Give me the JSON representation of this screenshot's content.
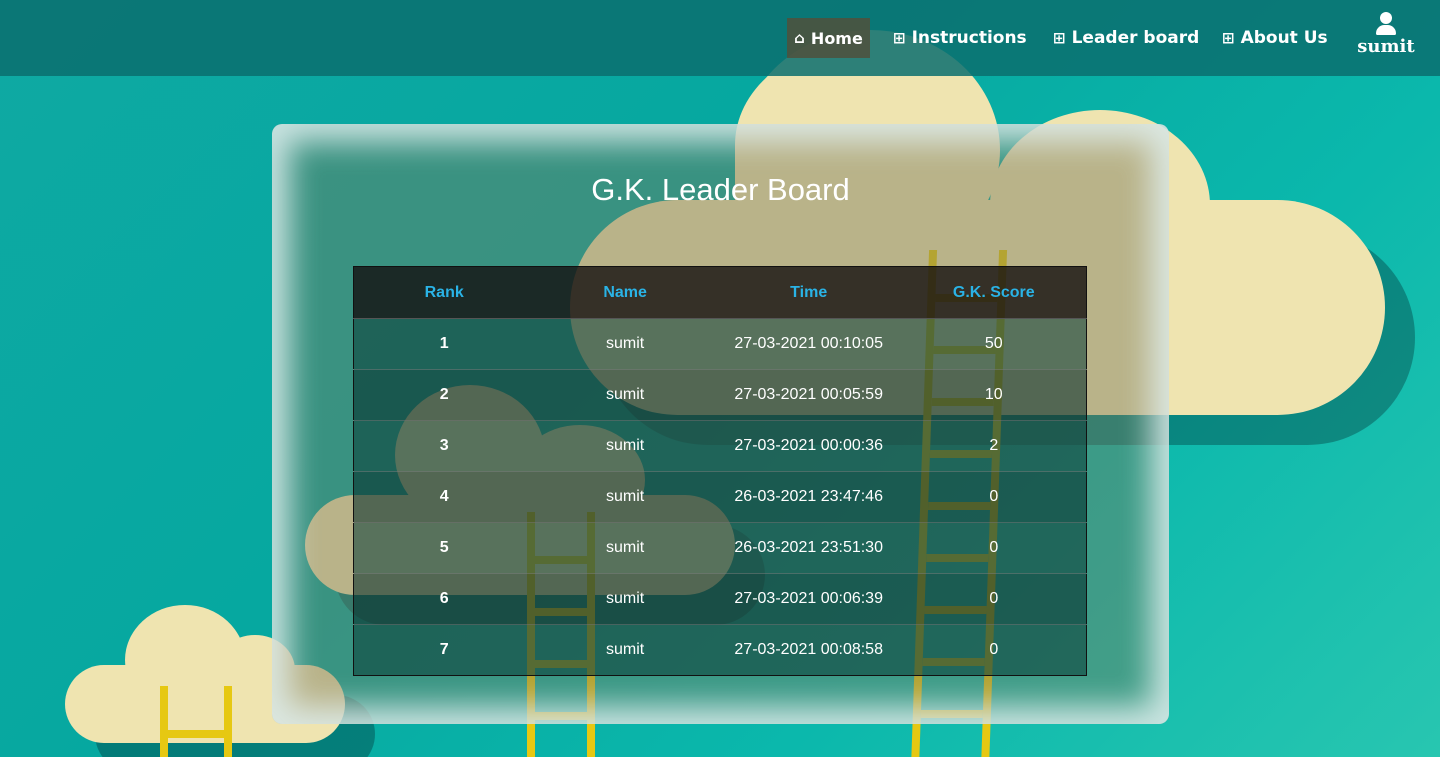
{
  "nav": {
    "home_icon": "home-icon",
    "home": "Home",
    "instructions_icon": "table-icon",
    "instructions": "Instructions",
    "leaderboard_icon": "table-icon",
    "leaderboard": "Leader board",
    "about_icon": "table-icon",
    "about": "About Us",
    "user_icon": "user-icon",
    "user": "sumit"
  },
  "page": {
    "title": "G.K. Leader Board"
  },
  "table": {
    "headers": [
      "Rank",
      "Name",
      "Time",
      "G.K. Score"
    ],
    "rows": [
      {
        "rank": "1",
        "name": "sumit",
        "time": "27-03-2021 00:10:05",
        "score": "50"
      },
      {
        "rank": "2",
        "name": "sumit",
        "time": "27-03-2021 00:05:59",
        "score": "10"
      },
      {
        "rank": "3",
        "name": "sumit",
        "time": "27-03-2021 00:00:36",
        "score": "2"
      },
      {
        "rank": "4",
        "name": "sumit",
        "time": "26-03-2021 23:47:46",
        "score": "0"
      },
      {
        "rank": "5",
        "name": "sumit",
        "time": "26-03-2021 23:51:30",
        "score": "0"
      },
      {
        "rank": "6",
        "name": "sumit",
        "time": "27-03-2021 00:06:39",
        "score": "0"
      },
      {
        "rank": "7",
        "name": "sumit",
        "time": "27-03-2021 00:08:58",
        "score": "0"
      }
    ]
  },
  "colors": {
    "header_text": "#2ab3e6",
    "navbar": "#0a6e6e"
  }
}
